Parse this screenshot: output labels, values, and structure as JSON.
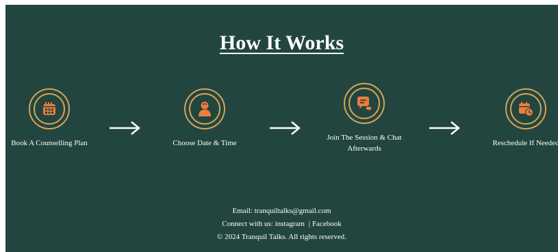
{
  "section": {
    "title": "How It Works"
  },
  "steps": [
    {
      "label": "Book A Counselling Plan",
      "icon": "calendar-icon"
    },
    {
      "label": "Choose Date & Time",
      "icon": "person-icon"
    },
    {
      "label": "Join The Session & Chat Afterwards",
      "icon": "chat-bubble-icon"
    },
    {
      "label": "Reschedule If Needed",
      "icon": "calendar-clock-icon"
    }
  ],
  "arrows": [
    "arrow-right-icon",
    "arrow-right-icon",
    "arrow-right-icon"
  ],
  "footer": {
    "email_text": "Email: tranquiltalks@gmail.com",
    "connect_prefix": "Connect with us:",
    "instagram": "instagram",
    "separator": "|",
    "facebook": "Facebook",
    "copyright": "© 2024 Tranquil Talks. All rights reserved."
  },
  "colors": {
    "background": "#224540",
    "ring": "#d7a453",
    "icon": "#ef7d3b",
    "text": "#ffffff"
  }
}
